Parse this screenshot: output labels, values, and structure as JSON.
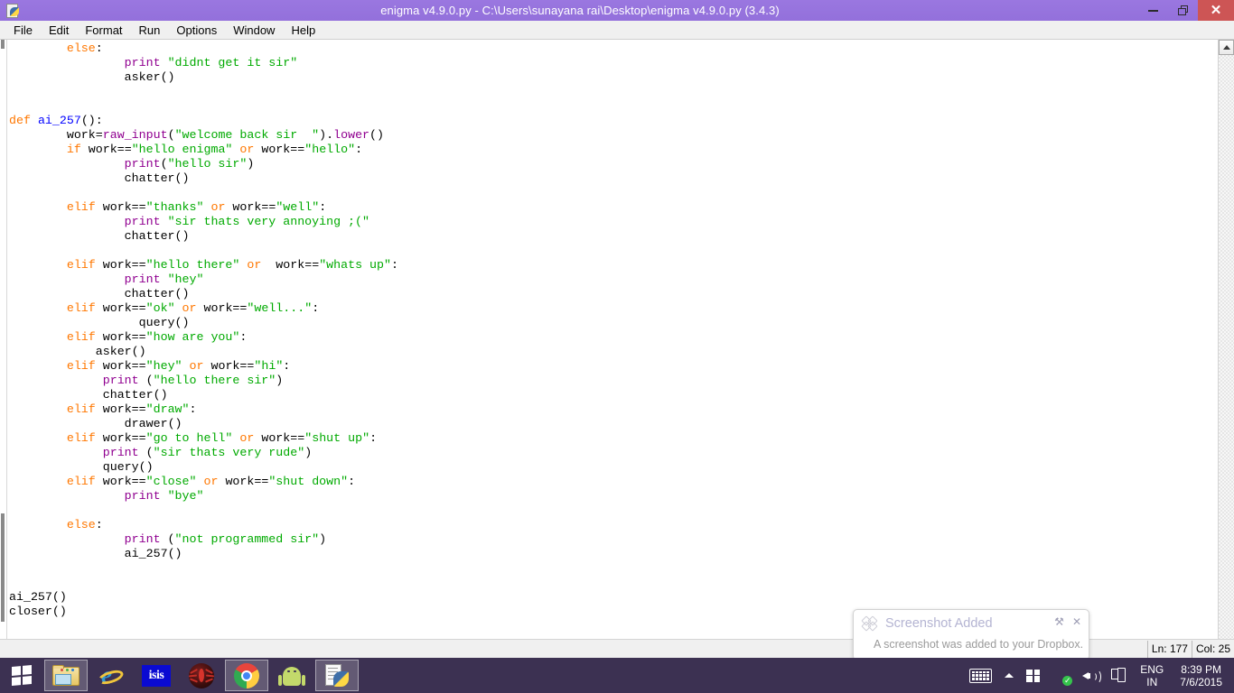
{
  "window": {
    "title": "enigma v4.9.0.py - C:\\Users\\sunayana rai\\Desktop\\enigma v4.9.0.py (3.4.3)",
    "app_icon": "python-idle-icon",
    "controls": {
      "minimize": "–",
      "maximize": "❐",
      "close": "✕"
    }
  },
  "menubar": {
    "items": [
      {
        "label": "File"
      },
      {
        "label": "Edit"
      },
      {
        "label": "Format"
      },
      {
        "label": "Run"
      },
      {
        "label": "Options"
      },
      {
        "label": "Window"
      },
      {
        "label": "Help"
      }
    ]
  },
  "editor": {
    "language": "python",
    "code_lines": [
      "        else:",
      "                print \"didnt get it sir\"",
      "                asker()",
      "",
      "",
      "def ai_257():",
      "        work=raw_input(\"welcome back sir  \").lower()",
      "        if work==\"hello enigma\" or work==\"hello\":",
      "                print(\"hello sir\")",
      "                chatter()",
      "",
      "        elif work==\"thanks\" or work==\"well\":",
      "                print \"sir thats very annoying ;(\"",
      "                chatter()",
      "",
      "        elif work==\"hello there\" or  work==\"whats up\":",
      "                print \"hey\"",
      "                chatter()",
      "        elif work==\"ok\" or work==\"well...\":",
      "                  query()",
      "        elif work==\"how are you\":",
      "            asker()",
      "        elif work==\"hey\" or work==\"hi\":",
      "             print (\"hello there sir\")",
      "             chatter()",
      "        elif work==\"draw\":",
      "                drawer()",
      "        elif work==\"go to hell\" or work==\"shut up\":",
      "             print (\"sir thats very rude\")",
      "             query()",
      "        elif work==\"close\" or work==\"shut down\":",
      "                print \"bye\"",
      "",
      "        else:",
      "                print (\"not programmed sir\")",
      "                ai_257()",
      "",
      "",
      "ai_257()",
      "closer()"
    ],
    "colors": {
      "keyword": "#ff7700",
      "string": "#00aa00",
      "builtin": "#900090",
      "definition": "#0000ff",
      "text": "#000000",
      "background": "#ffffff"
    }
  },
  "statusbar": {
    "line_label": "Ln: 177",
    "col_label": "Col: 25"
  },
  "toast": {
    "icon": "dropbox-icon",
    "title": "Screenshot Added",
    "body": "A screenshot was added to your Dropbox.",
    "settings_icon": "⚒",
    "close_icon": "✕"
  },
  "taskbar": {
    "start": {
      "label": "Start",
      "icon": "windows-logo-icon"
    },
    "items": [
      {
        "name": "file-explorer",
        "label": "File Explorer",
        "active": true
      },
      {
        "name": "internet-explorer",
        "label": "Internet Explorer",
        "active": false
      },
      {
        "name": "isis",
        "label": "ISIS",
        "active": false
      },
      {
        "name": "spider",
        "label": "Spider",
        "active": false
      },
      {
        "name": "google-chrome",
        "label": "Google Chrome",
        "active": true
      },
      {
        "name": "android",
        "label": "Android",
        "active": false
      },
      {
        "name": "python-idle",
        "label": "Python IDLE",
        "active": true
      }
    ],
    "tray": {
      "keyboard_icon": "keyboard-icon",
      "show_hidden_icon": "chevron-up-icon",
      "action_center_icon": "action-center-icon",
      "dropbox_icon": "dropbox-tray-icon",
      "dropbox_badge": "✓",
      "volume_icon": "speaker-icon",
      "network_icon": "network-icon",
      "language_line1": "ENG",
      "language_line2": "IN",
      "time": "8:39 PM",
      "date": "7/6/2015"
    }
  }
}
